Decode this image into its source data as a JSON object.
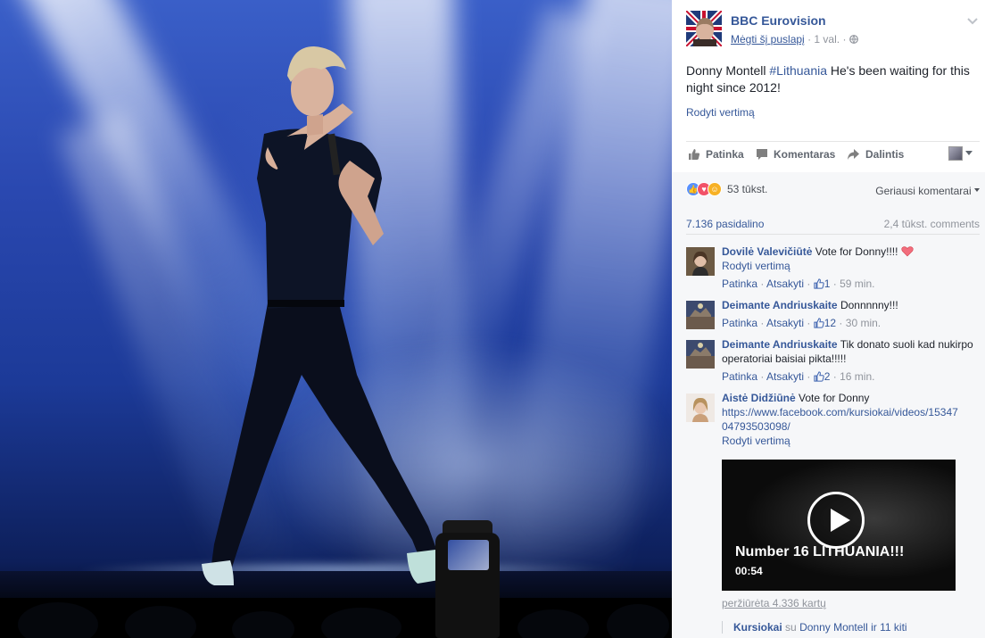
{
  "photo": {
    "description_icon": "concert-photo"
  },
  "post": {
    "page_name": "BBC Eurovision",
    "like_page": "Mėgti šį puslapį",
    "time": "1 val.",
    "text_prefix": "Donny Montell ",
    "hashtag": "#Lithuania",
    "text_suffix": " He's been waiting for this night since 2012!",
    "translate": "Rodyti vertimą"
  },
  "actions": {
    "like": "Patinka",
    "comment": "Komentaras",
    "share": "Dalintis"
  },
  "stats": {
    "reactions_count": "53 tūkst.",
    "top_comments": "Geriausi komentarai",
    "shares": "7.136 pasidalino",
    "comments_count": "2,4 tūkst. comments"
  },
  "comments": [
    {
      "author": "Dovilė Valevičiūtė",
      "text": "Vote for Donny!!!!",
      "translate": "Rodyti vertimą",
      "like": "Patinka",
      "reply": "Atsakyti",
      "likes": "1",
      "time": "59 min."
    },
    {
      "author": "Deimante Andriuskaite",
      "text": "Donnnnny!!!",
      "like": "Patinka",
      "reply": "Atsakyti",
      "likes": "12",
      "time": "30 min."
    },
    {
      "author": "Deimante Andriuskaite",
      "text": "Tik donato suoli kad nukirpo operatoriai baisiai pikta!!!!!",
      "like": "Patinka",
      "reply": "Atsakyti",
      "likes": "2",
      "time": "16 min."
    },
    {
      "author": "Aistė Didžiūnė",
      "text": "Vote for Donny",
      "link_line1": "https://www.facebook.com/kursiokai/videos/15347",
      "link_line2": "04793503098/",
      "translate": "Rodyti vertimą"
    }
  ],
  "video": {
    "title": "Number 16 LITHUANIA!!!",
    "duration": "00:54",
    "views": "peržiūrėta 4.336 kartų",
    "shared_by": "Kursiokai",
    "shared_with": "su",
    "shared_names": "Donny Montell",
    "shared_more": "ir 11 kiti"
  },
  "colors": {
    "link": "#365899",
    "text": "#1d2129",
    "muted": "#90949c"
  }
}
